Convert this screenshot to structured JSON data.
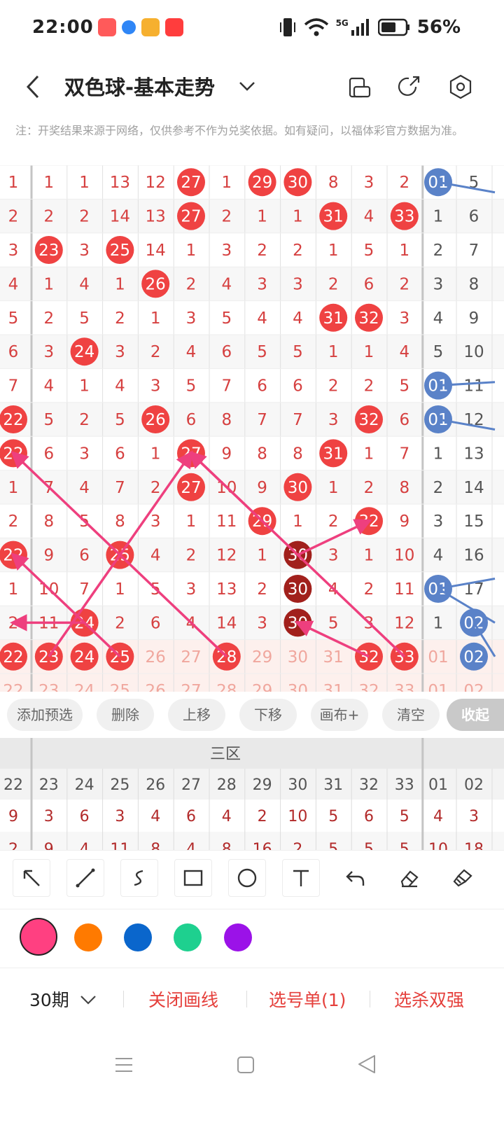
{
  "status_bar": {
    "time": "22:00",
    "network": "5G",
    "battery": "56%"
  },
  "header": {
    "title": "双色球-基本走势"
  },
  "notice": "注：开奖结果来源于网络，仅供参考不作为兑奖依据。如有疑问，以福体彩官方数据为准。",
  "trend_grid": {
    "columns": [
      "22",
      "23",
      "24",
      "25",
      "26",
      "27",
      "28",
      "29",
      "30",
      "31",
      "32",
      "33",
      "01",
      "02"
    ],
    "rows": [
      {
        "cells": [
          "1",
          "1",
          "1",
          "13",
          "12",
          "27",
          "1",
          "29",
          "30",
          "8",
          "3",
          "2",
          "01",
          "5"
        ],
        "hits": [
          5,
          7,
          8
        ],
        "blue_hits": [
          12
        ]
      },
      {
        "cells": [
          "2",
          "2",
          "2",
          "14",
          "13",
          "27",
          "2",
          "1",
          "1",
          "31",
          "4",
          "33",
          "1",
          "6"
        ],
        "hits": [
          5,
          9,
          11
        ],
        "blue_hits": []
      },
      {
        "cells": [
          "3",
          "23",
          "3",
          "25",
          "14",
          "1",
          "3",
          "2",
          "2",
          "1",
          "5",
          "1",
          "2",
          "7"
        ],
        "hits": [
          1,
          3
        ],
        "blue_hits": []
      },
      {
        "cells": [
          "4",
          "1",
          "4",
          "1",
          "26",
          "2",
          "4",
          "3",
          "3",
          "2",
          "6",
          "2",
          "3",
          "8"
        ],
        "hits": [
          4
        ],
        "blue_hits": []
      },
      {
        "cells": [
          "5",
          "2",
          "5",
          "2",
          "1",
          "3",
          "5",
          "4",
          "4",
          "31",
          "32",
          "3",
          "4",
          "9"
        ],
        "hits": [
          9,
          10
        ],
        "blue_hits": []
      },
      {
        "cells": [
          "6",
          "3",
          "24",
          "3",
          "2",
          "4",
          "6",
          "5",
          "5",
          "1",
          "1",
          "4",
          "5",
          "10"
        ],
        "hits": [
          2
        ],
        "blue_hits": []
      },
      {
        "cells": [
          "7",
          "4",
          "1",
          "4",
          "3",
          "5",
          "7",
          "6",
          "6",
          "2",
          "2",
          "5",
          "01",
          "11"
        ],
        "hits": [],
        "blue_hits": [
          12
        ]
      },
      {
        "cells": [
          "22",
          "5",
          "2",
          "5",
          "26",
          "6",
          "8",
          "7",
          "7",
          "3",
          "32",
          "6",
          "01",
          "12"
        ],
        "hits": [
          0,
          4,
          10
        ],
        "blue_hits": [
          12
        ]
      },
      {
        "cells": [
          "22",
          "6",
          "3",
          "6",
          "1",
          "27",
          "9",
          "8",
          "8",
          "31",
          "1",
          "7",
          "1",
          "13"
        ],
        "hits": [
          0,
          5,
          9
        ],
        "blue_hits": []
      },
      {
        "cells": [
          "1",
          "7",
          "4",
          "7",
          "2",
          "27",
          "10",
          "9",
          "30",
          "1",
          "2",
          "8",
          "2",
          "14"
        ],
        "hits": [
          5,
          8
        ],
        "blue_hits": []
      },
      {
        "cells": [
          "2",
          "8",
          "5",
          "8",
          "3",
          "1",
          "11",
          "29",
          "1",
          "2",
          "32",
          "9",
          "3",
          "15"
        ],
        "hits": [
          7,
          10
        ],
        "blue_hits": []
      },
      {
        "cells": [
          "22",
          "9",
          "6",
          "25",
          "4",
          "2",
          "12",
          "1",
          "30",
          "3",
          "1",
          "10",
          "4",
          "16"
        ],
        "hits": [
          0,
          3
        ],
        "dark_hits": [
          8
        ],
        "blue_hits": []
      },
      {
        "cells": [
          "1",
          "10",
          "7",
          "1",
          "5",
          "3",
          "13",
          "2",
          "30",
          "4",
          "2",
          "11",
          "01",
          "17"
        ],
        "hits": [],
        "dark_hits": [
          8
        ],
        "blue_hits": [
          12
        ]
      },
      {
        "cells": [
          "2",
          "11",
          "24",
          "2",
          "6",
          "4",
          "14",
          "3",
          "30",
          "5",
          "3",
          "12",
          "1",
          "02"
        ],
        "hits": [
          2
        ],
        "dark_hits": [
          8
        ],
        "blue_hits": [
          13
        ]
      },
      {
        "cells": [
          "22",
          "23",
          "24",
          "25",
          "26",
          "27",
          "28",
          "29",
          "30",
          "31",
          "32",
          "33",
          "01",
          "02"
        ],
        "hits": [
          0,
          1,
          2,
          3,
          6,
          10,
          11
        ],
        "blue_hits": [
          13
        ],
        "preview": true
      },
      {
        "cells": [
          "22",
          "23",
          "24",
          "25",
          "26",
          "27",
          "28",
          "29",
          "30",
          "31",
          "32",
          "33",
          "01",
          "02"
        ],
        "hits": [],
        "blue_hits": [],
        "preview": true
      }
    ]
  },
  "actions": {
    "add_preselect": "添加预选",
    "delete": "删除",
    "move_up": "上移",
    "move_down": "下移",
    "canvas_plus": "画布+",
    "clear": "清空",
    "collapse": "收起"
  },
  "stats_table": {
    "section_label": "三区",
    "columns": [
      "22",
      "23",
      "24",
      "25",
      "26",
      "27",
      "28",
      "29",
      "30",
      "31",
      "32",
      "33",
      "01",
      "02"
    ],
    "row1": [
      "9",
      "3",
      "6",
      "3",
      "4",
      "6",
      "4",
      "2",
      "10",
      "5",
      "6",
      "5",
      "4",
      "3"
    ],
    "row2": [
      "2",
      "9",
      "4",
      "11",
      "8",
      "4",
      "8",
      "16",
      "2",
      "5",
      "5",
      "5",
      "10",
      "18"
    ]
  },
  "tools": [
    "arrow-tool",
    "line-tool",
    "curve-tool",
    "rect-tool",
    "circle-tool",
    "text-tool",
    "undo-tool",
    "eraser-tool",
    "brush-clear-tool"
  ],
  "palette": {
    "selected": "#ff4081",
    "colors": [
      "#ff4081",
      "#ff7a00",
      "#0a66cc",
      "#1ed08f",
      "#9b12e8"
    ]
  },
  "bottom_bar": {
    "periods": "30期",
    "close_lines": "关闭画线",
    "pick_list": "选号单(1)",
    "kill_strong": "选杀双强"
  },
  "theme": {
    "red_ball": "#ef4242",
    "dark_ball": "#a1201c",
    "blue_ball": "#5a82c8",
    "line_pink": "#ee3f7e"
  }
}
